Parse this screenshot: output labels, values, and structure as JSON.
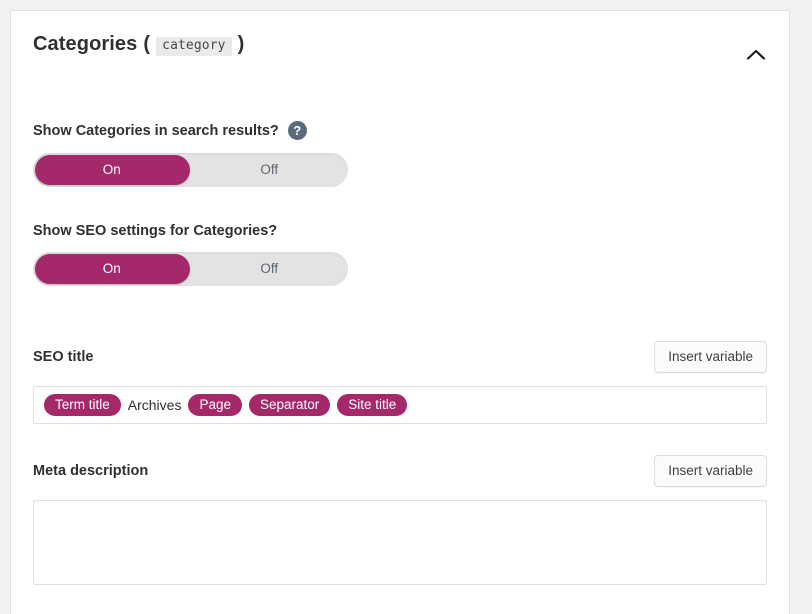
{
  "panel": {
    "title": "Categories",
    "taxonomy_slug": "category",
    "paren_open": "(",
    "paren_close": ")",
    "collapse_icon": "chevron-up-icon",
    "expanded": true
  },
  "settings": [
    {
      "label": "Show Categories in search results?",
      "help_icon": "help-circle-icon",
      "help_glyph": "?",
      "has_help": true,
      "options": [
        "On",
        "Off"
      ],
      "selected": "On"
    },
    {
      "label": "Show SEO settings for Categories?",
      "has_help": false,
      "options": [
        "On",
        "Off"
      ],
      "selected": "On"
    }
  ],
  "seo_title": {
    "label": "SEO title",
    "insert_variable_label": "Insert variable",
    "tokens": [
      {
        "text": "Term title",
        "type": "variable"
      },
      {
        "text": "Archives",
        "type": "text"
      },
      {
        "text": "Page",
        "type": "variable"
      },
      {
        "text": "Separator",
        "type": "variable"
      },
      {
        "text": "Site title",
        "type": "variable"
      }
    ]
  },
  "meta_description": {
    "label": "Meta description",
    "insert_variable_label": "Insert variable",
    "value": "",
    "placeholder": ""
  },
  "colors": {
    "accent": "#a4286a",
    "page_background": "#f1f1f1",
    "card_background": "#ffffff",
    "toggle_track": "#e3e3e3",
    "text": "#303030",
    "muted_text": "#5c6570",
    "border": "#e0e0e0",
    "help_icon": "#5b6a7a"
  }
}
